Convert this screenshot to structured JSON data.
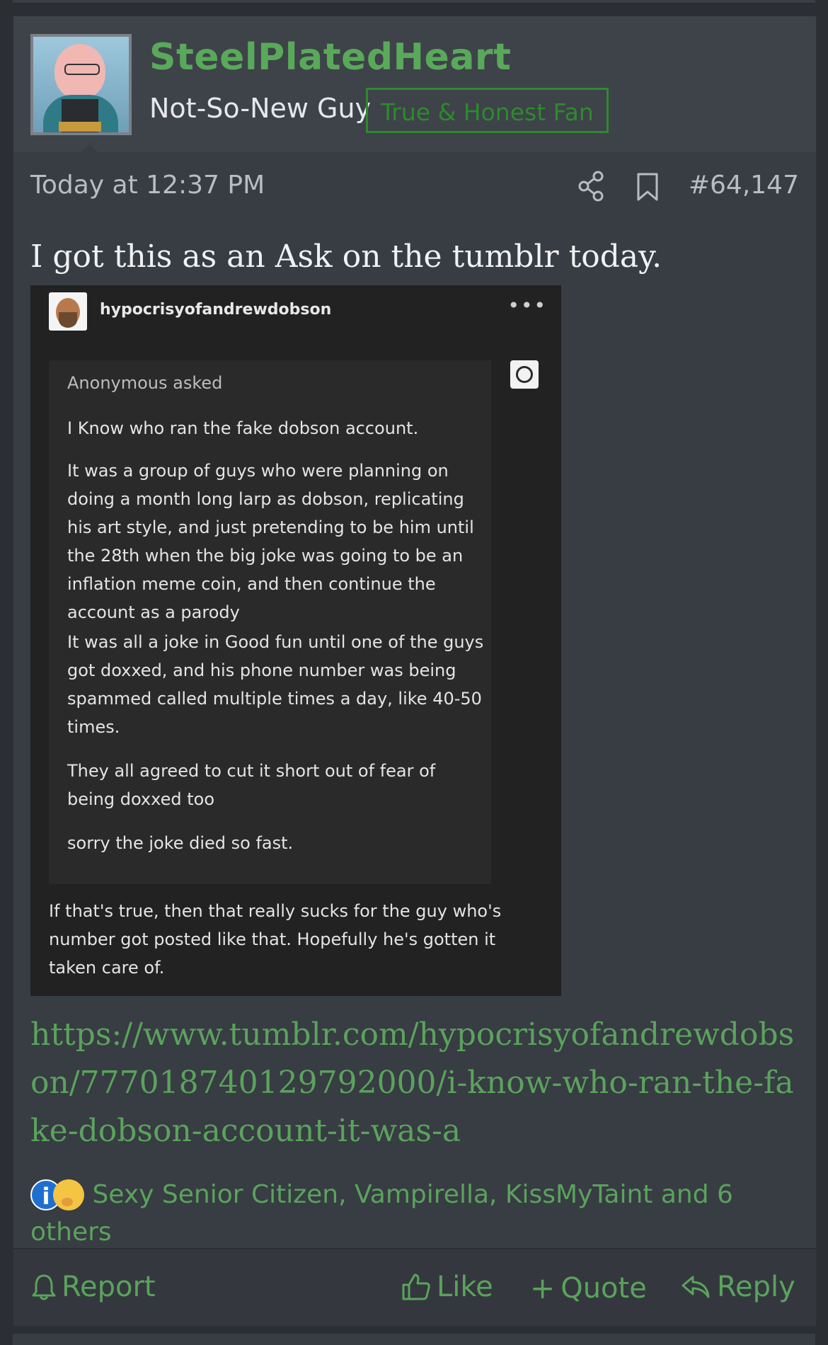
{
  "post": {
    "username": "SteelPlatedHeart",
    "user_title": "Not-So-New Guy",
    "user_banner": "True & Honest Fan",
    "timestamp": "Today at 12:37 PM",
    "post_number": "#64,147",
    "body_text": "I got this as an Ask on the tumblr today.",
    "link": "https://www.tumblr.com/hypocrisyofandrewdobson/777018740129792000/i-know-who-ran-the-fake-dobson-account-it-was-a",
    "reactions_text": "Sexy Senior Citizen, Vampirella, KissMyTaint and 6 others",
    "footer": {
      "report": "Report",
      "like": "Like",
      "quote": "Quote",
      "reply": "Reply"
    }
  },
  "screenshot": {
    "blog_name": "hypocrisyofandrewdobson",
    "more": "•••",
    "asker": "Anonymous asked",
    "q1": "I Know who ran the fake dobson account.",
    "q2": "It was a group of guys who were planning on doing a month long larp as dobson, replicating his art style, and just pretending to be him until the 28th when the big joke was going to be an inflation meme coin, and then continue the account as a parody",
    "q3": "It was all a joke in Good fun until one of the guys got doxxed, and his phone number was being spammed called multiple times a day, like 40-50 times.",
    "q4": "They all agreed to cut it short out of fear of being doxxed too",
    "q5": "sorry the joke died so fast.",
    "answer": "If that's true, then that really sucks for the guy who's number got posted like that. Hopefully he's gotten it taken care of."
  },
  "colors": {
    "accent_green": "#5aa35c",
    "username_green": "#59a95a",
    "banner_green": "#2d8a2d",
    "background": "#2b2e33",
    "post_bg": "#383c43"
  },
  "icons": {
    "share": "share-icon",
    "bookmark": "bookmark-icon",
    "bell": "bell-icon",
    "thumbs_up": "thumbs-up-icon",
    "plus": "plus-icon",
    "reply_arrow": "reply-arrow-icon",
    "info_reaction": "info-reaction-icon",
    "thinking_reaction": "thinking-reaction-icon"
  }
}
